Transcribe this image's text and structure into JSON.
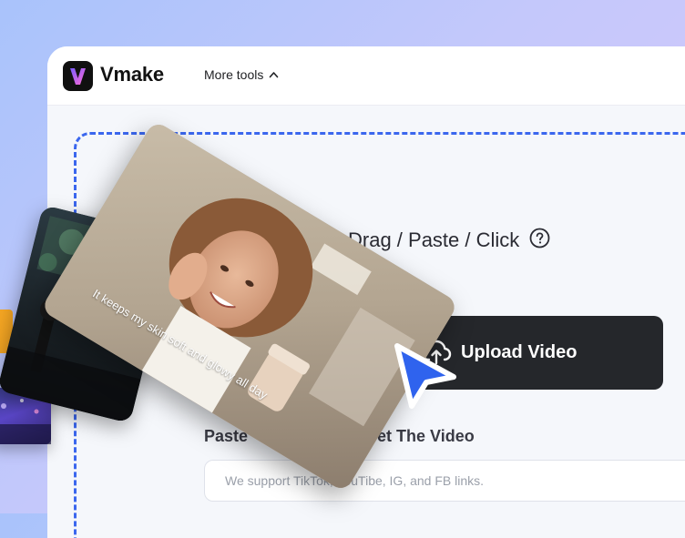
{
  "header": {
    "brand_name": "Vmake",
    "logo_letter": "V",
    "more_tools_label": "More tools"
  },
  "upload": {
    "hint": "Drag / Paste / Click",
    "button_label": "Upload Video"
  },
  "paste": {
    "title": "Paste ... To Get The Video",
    "title_visible_left": "Paste",
    "title_visible_right": "o Get The Video",
    "input_placeholder": "We support TikTok, YouTibe, IG, and FB links."
  },
  "preview": {
    "caption": "It keeps my skin soft and glowy all day"
  },
  "icons": {
    "logo": "vmake-logo-icon",
    "more_tools_chevron": "chevron-up-icon",
    "help": "question-circle-icon",
    "upload": "cloud-upload-icon",
    "cursor": "pointer-cursor-icon"
  },
  "colors": {
    "accent": "#3b67ee",
    "button_bg": "#25272b",
    "page_bg": "#f5f7fb",
    "logo_gradient_start": "#7b5cff",
    "logo_gradient_end": "#ff6ad5",
    "cursor": "#2f63ee"
  }
}
